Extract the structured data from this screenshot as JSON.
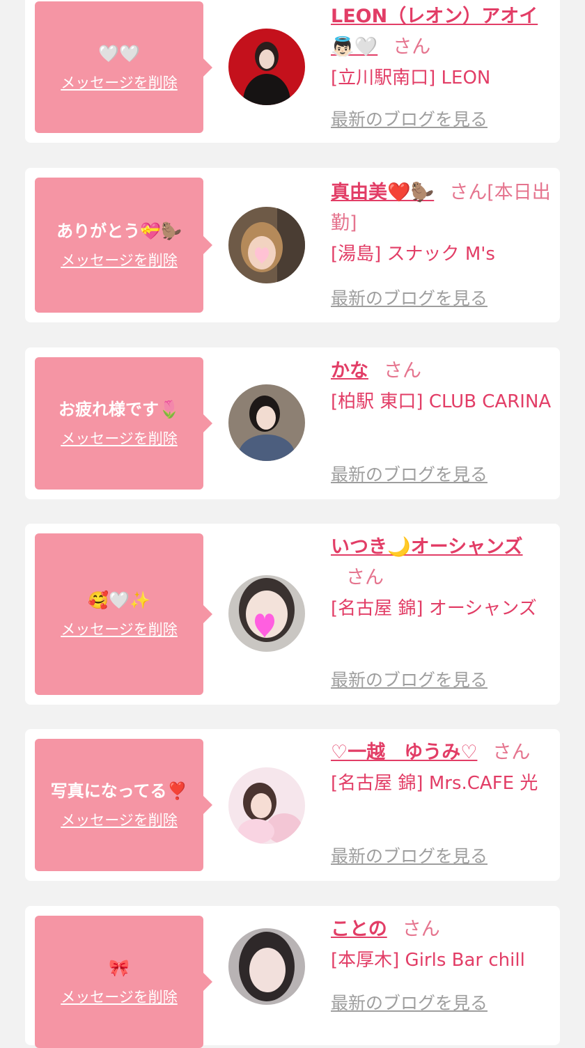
{
  "common": {
    "delete_label": "メッセージを削除",
    "san_label": "さん",
    "blog_label": "最新のブログを見る"
  },
  "colors": {
    "background": "#f2f2f2",
    "card": "#ffffff",
    "bubble": "#f595a4",
    "accent": "#e23d66",
    "muted": "#9e9e9e"
  },
  "messages": [
    {
      "message": "🤍🤍",
      "name": "LEON（レオン）アオイ👼🏻🤍",
      "suffix": "",
      "shop": "[立川駅南口] LEON"
    },
    {
      "message": "ありがとう💝🦫",
      "name": "真由美❤️🦫",
      "suffix": "[本日出勤]",
      "shop": "[湯島] スナック M's"
    },
    {
      "message": "お疲れ様です🌷",
      "name": "かな",
      "suffix": "",
      "shop": "[柏駅 東口] CLUB CARINA"
    },
    {
      "message": "🥰🤍✨",
      "name": "いつき🌙オーシャンズ",
      "suffix": "",
      "shop": "[名古屋 錦] オーシャンズ"
    },
    {
      "message": "写真になってる❣️",
      "name": "♡一越　ゆうみ♡",
      "suffix": "",
      "shop": "[名古屋 錦] Mrs.CAFE 光"
    },
    {
      "message": "🎀",
      "name": "ことの",
      "suffix": "",
      "shop": "[本厚木] Girls Bar chill"
    }
  ]
}
